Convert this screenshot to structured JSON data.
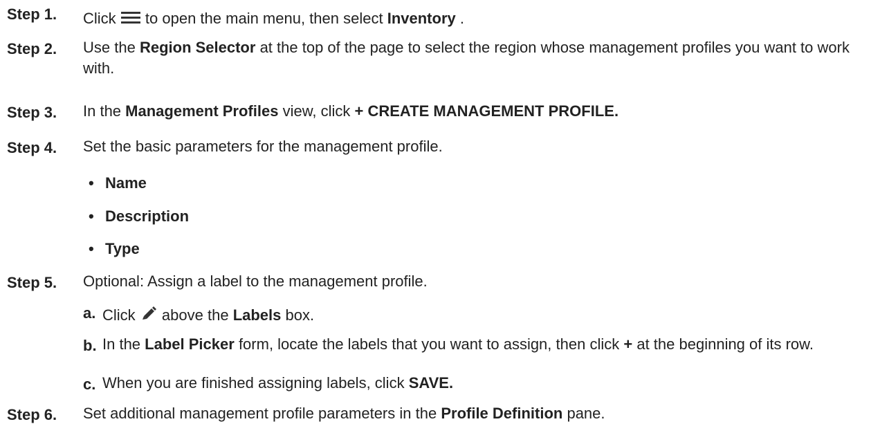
{
  "steps": [
    {
      "label": "Step 1.",
      "pre": "Click",
      "mid": "to open the main menu, then select",
      "bold": "Inventory",
      "post": "."
    },
    {
      "label": "Step 2.",
      "pre": "Use the",
      "bold": "Region Selector",
      "post": "at the top of the page to select the region whose management profiles you want to work with."
    },
    {
      "label": "Step 3.",
      "pre": "In the",
      "bold": "Management Profiles",
      "mid": "view, click",
      "bold2": "+ CREATE MANAGEMENT PROFILE."
    },
    {
      "label": "Step 4.",
      "text": "Set the basic parameters for the management profile."
    },
    {
      "label": "Step 5.",
      "text": "Optional: Assign a label to the management profile."
    },
    {
      "label": "Step 6.",
      "pre": "Set additional management profile parameters in the",
      "bold": "Profile Definition",
      "post": "pane."
    }
  ],
  "bullets": [
    "Name",
    "Description",
    "Type"
  ],
  "bullet_symbol": "•",
  "substeps": [
    {
      "letter": "a.",
      "pre": "Click",
      "mid": "above the",
      "bold": "Labels",
      "post": "box."
    },
    {
      "letter": "b.",
      "pre": "In the",
      "bold": "Label Picker",
      "mid": "form, locate the labels that you want to assign, then click",
      "bold2": "+",
      "post": "at the beginning of its row."
    },
    {
      "letter": "c.",
      "pre": "When you are finished assigning labels, click",
      "bold": "SAVE."
    }
  ],
  "icons": {
    "menu": "hamburger-menu-icon",
    "edit": "pencil-icon"
  }
}
